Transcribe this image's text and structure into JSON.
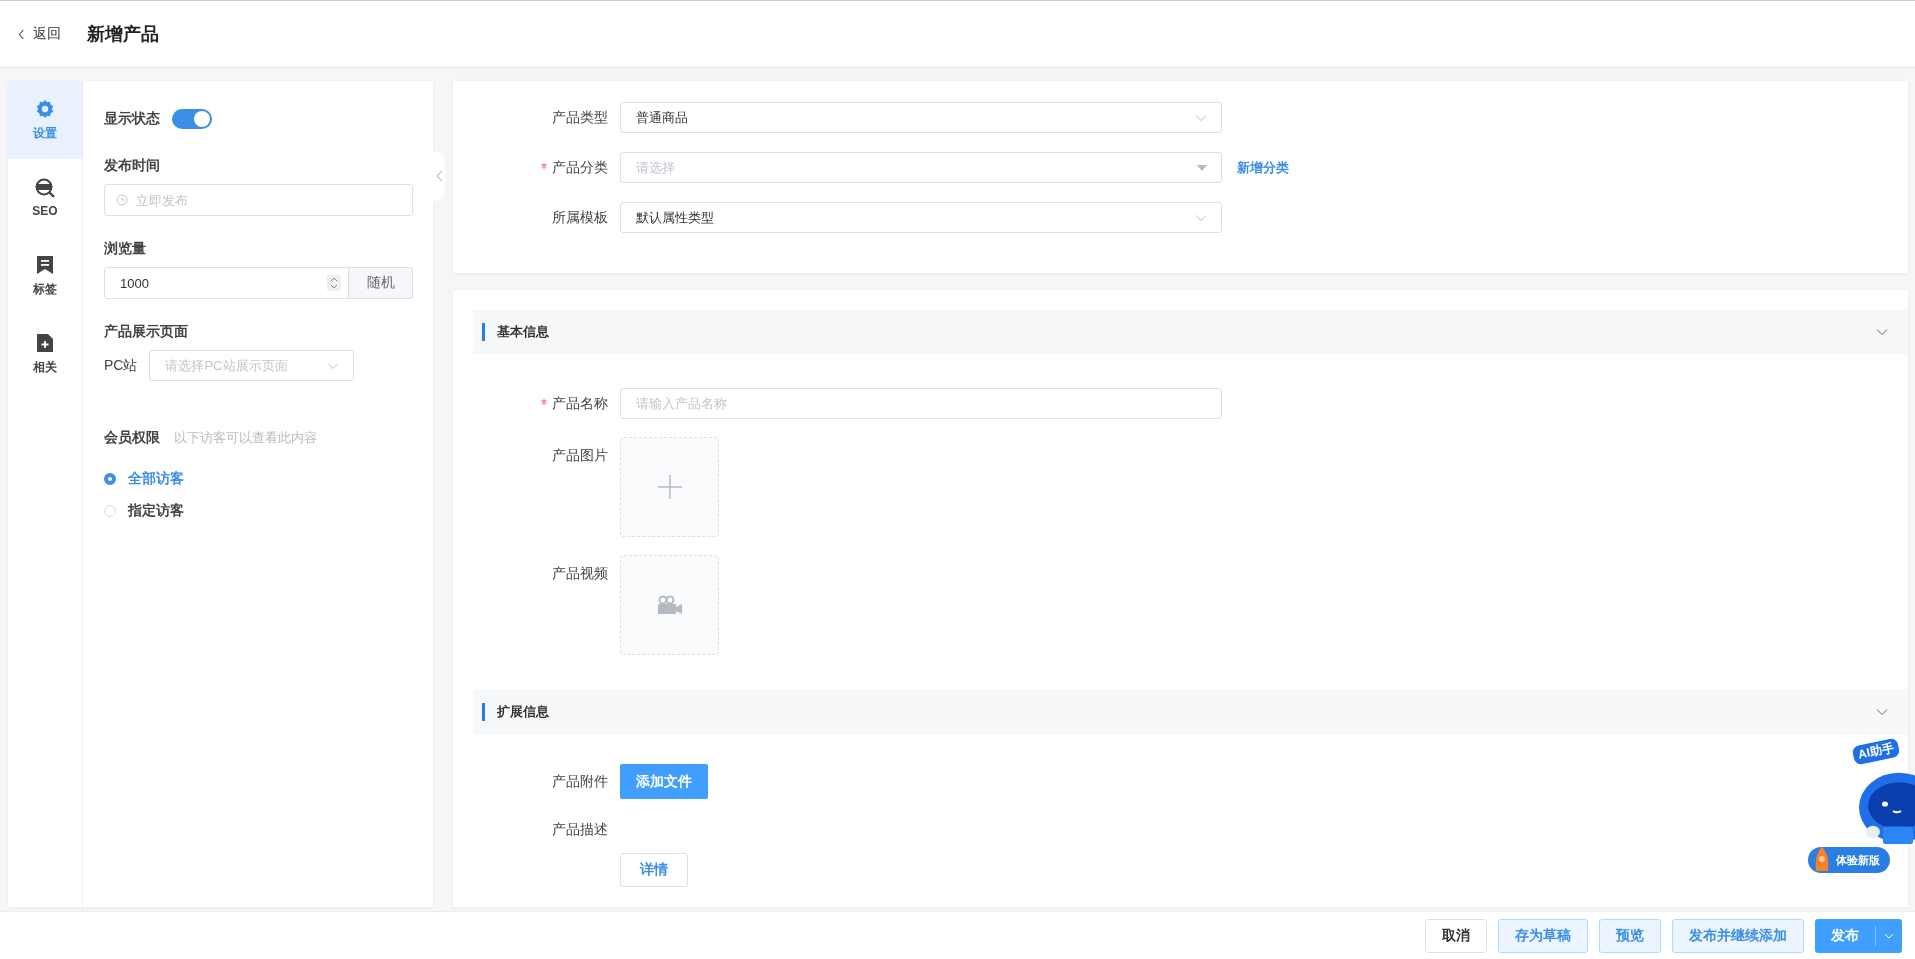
{
  "header": {
    "back": "返回",
    "title": "新增产品"
  },
  "side_tabs": [
    {
      "label": "设置",
      "kind": "settings",
      "selected": true
    },
    {
      "label": "SEO",
      "kind": "seo",
      "selected": false
    },
    {
      "label": "标签",
      "kind": "tag",
      "selected": false
    },
    {
      "label": "相关",
      "kind": "related",
      "selected": false
    }
  ],
  "settings": {
    "display_status": {
      "label": "显示状态",
      "on": true
    },
    "publish_time": {
      "label": "发布时间",
      "placeholder": "立即发布"
    },
    "views": {
      "label": "浏览量",
      "value": "1000",
      "button": "随机"
    },
    "display_page": {
      "label": "产品展示页面",
      "site": "PC站",
      "placeholder": "请选择PC站展示页面"
    },
    "member": {
      "label": "会员权限",
      "hint": "以下访客可以查看此内容",
      "options": [
        {
          "label": "全部访客",
          "selected": true
        },
        {
          "label": "指定访客",
          "selected": false
        }
      ]
    }
  },
  "top_form": [
    {
      "label": "产品类型",
      "required": false,
      "kind": "select",
      "value": "普通商品"
    },
    {
      "label": "产品分类",
      "required": true,
      "kind": "cascader",
      "placeholder": "请选择",
      "link": "新增分类"
    },
    {
      "label": "所属模板",
      "required": false,
      "kind": "select",
      "value": "默认属性类型"
    }
  ],
  "sections": [
    {
      "title": "基本信息",
      "expanded": true,
      "fields": [
        {
          "label": "产品名称",
          "required": true,
          "kind": "input",
          "placeholder": "请输入产品名称"
        },
        {
          "label": "产品图片",
          "required": false,
          "kind": "image_upload"
        },
        {
          "label": "产品视频",
          "required": false,
          "kind": "video_upload"
        }
      ]
    },
    {
      "title": "扩展信息",
      "expanded": true,
      "fields": [
        {
          "label": "产品附件",
          "required": false,
          "kind": "button",
          "button": "添加文件"
        },
        {
          "label": "产品描述",
          "required": false,
          "kind": "editor",
          "button": "详情"
        }
      ]
    }
  ],
  "footer_buttons": [
    {
      "label": "取消",
      "kind": "default"
    },
    {
      "label": "存为草稿",
      "kind": "light"
    },
    {
      "label": "预览",
      "kind": "light"
    },
    {
      "label": "发布并继续添加",
      "kind": "light"
    },
    {
      "label": "发布",
      "kind": "split"
    }
  ],
  "floating": {
    "assistant": "AI助手",
    "new_version": "体验新版"
  }
}
